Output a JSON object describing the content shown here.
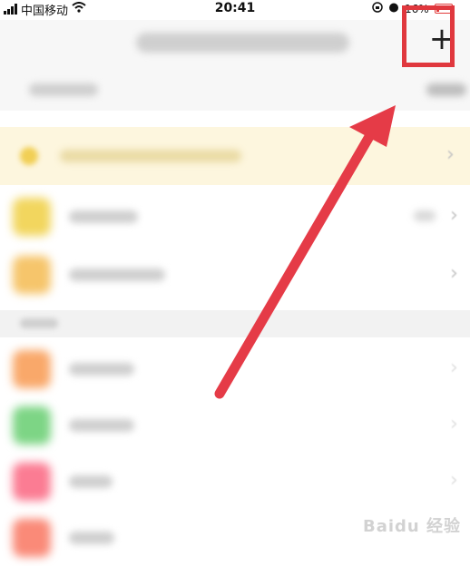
{
  "status_bar": {
    "carrier": "中国移动",
    "time": "20:41",
    "battery": "16%"
  },
  "nav": {
    "add_label": "+"
  },
  "rows": [
    {
      "icon_color": "#f2d65e",
      "has_count": true
    },
    {
      "icon_color": "#f6c56b",
      "has_count": false
    },
    {
      "icon_color": "#f9a86a",
      "has_count": false
    },
    {
      "icon_color": "#7dd585",
      "has_count": false
    },
    {
      "icon_color": "#fb7c93",
      "has_count": false
    },
    {
      "icon_color": "#fa8a78",
      "has_count": false
    }
  ],
  "annotation": {
    "box_color": "#e0383e",
    "arrow_color": "#e53b47"
  },
  "watermark": "Baidu 经验"
}
